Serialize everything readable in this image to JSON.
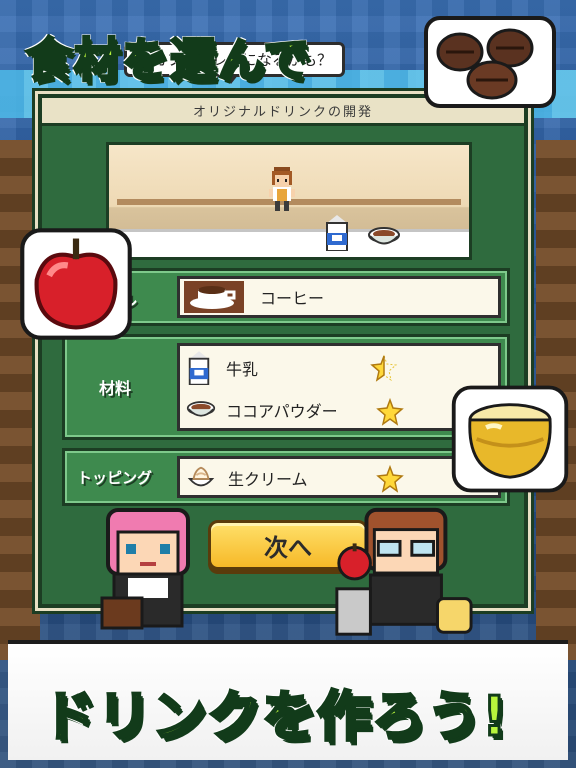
{
  "screen": {
    "headline_top": "食材を選んで",
    "headline_bottom": "ドリンクを作ろう!"
  },
  "dialog": {
    "header_title": "オリジナルドリンクの開発",
    "speech_bubble": "『カフェオレ』になるかも？",
    "base": {
      "label": "ル",
      "item": {
        "icon": "coffee-cup-icon",
        "name": "コーヒー"
      }
    },
    "ingredients": {
      "label": "材料",
      "items": [
        {
          "icon": "milk-carton-icon",
          "name": "牛乳",
          "rating": 0.5
        },
        {
          "icon": "cocoa-bowl-icon",
          "name": "ココアパウダー",
          "rating": 1
        }
      ]
    },
    "topping": {
      "label": "トッピング",
      "items": [
        {
          "icon": "whipped-cream-icon",
          "name": "生クリーム",
          "rating": 1
        }
      ]
    },
    "next_button": "次へ"
  },
  "colors": {
    "headline_fill": "#b8f53c",
    "headline_outline": "#123b1a",
    "dialog_green": "#3e8a4e",
    "button_gold": "#f6b928",
    "star_yellow": "#ffd83a"
  }
}
